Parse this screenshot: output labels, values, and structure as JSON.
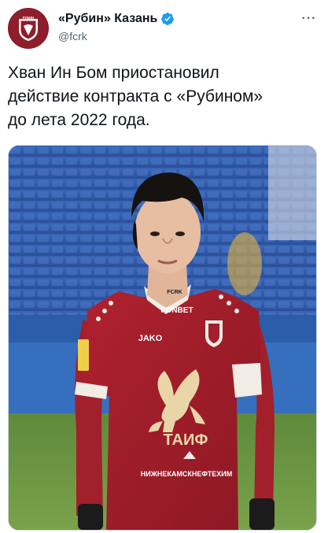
{
  "account": {
    "display_name": "«Рубин» Казань",
    "handle": "@fcrk",
    "avatar_text": "РУБИН",
    "verified": true
  },
  "tweet": {
    "text": "Хван Ин Бом приостановил\nдействие контракта с «Рубином»\nдо лета 2022 года."
  },
  "photo": {
    "jersey_text": {
      "collar": "FCRK",
      "sponsor": "FONBET",
      "maker": "JAKO",
      "main_sponsor": "ТАИФ",
      "bottom_sponsor": "НИЖНЕКАМСКНЕФТЕХИМ"
    }
  },
  "colors": {
    "brand": "#8e1e2b",
    "verified": "#1d9bf0",
    "secondary_text": "#536471"
  },
  "icons": {
    "more": "more-horizontal-icon",
    "verified": "verified-badge-icon"
  }
}
